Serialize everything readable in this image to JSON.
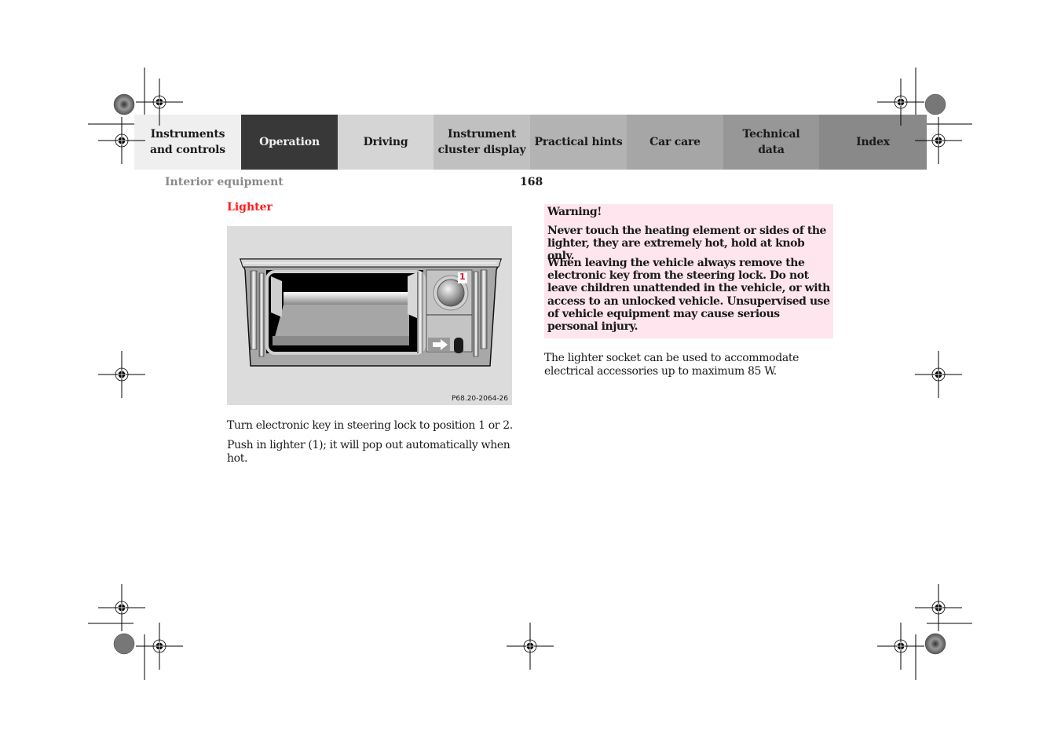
{
  "nav": {
    "tabs": [
      {
        "label": "Instruments\nand controls",
        "active": false
      },
      {
        "label": "Operation",
        "active": true
      },
      {
        "label": "Driving",
        "active": false
      },
      {
        "label": "Instrument\ncluster display",
        "active": false
      },
      {
        "label": "Practical hints",
        "active": false
      },
      {
        "label": "Car care",
        "active": false
      },
      {
        "label": "Technical\ndata",
        "active": false
      },
      {
        "label": "Index",
        "active": false
      }
    ]
  },
  "header": {
    "section": "Interior equipment",
    "page_number": "168"
  },
  "content": {
    "heading": "Lighter",
    "figure": {
      "callout": "1",
      "code": "P68.20-2064-26"
    },
    "instructions": [
      "Turn electronic key in steering lock to position 1 or 2.",
      "Push in lighter (1); it will pop out automatically when hot."
    ],
    "warning": {
      "title": "Warning!",
      "paragraphs": [
        "Never touch the heating element or sides of the lighter, they are extremely hot, hold at knob only.",
        "When leaving the vehicle always remove the electronic key from the steering lock. Do not leave children unattended in the vehicle, or with access to an unlocked vehicle. Unsupervised use of vehicle equipment may cause serious personal injury."
      ]
    },
    "note": "The lighter socket can be used to accommodate electrical accessories up to maximum 85 W."
  },
  "colors": {
    "heading": "#ff1a1a",
    "warning_bg": "#ffe6ee",
    "active_tab": "#383838"
  }
}
